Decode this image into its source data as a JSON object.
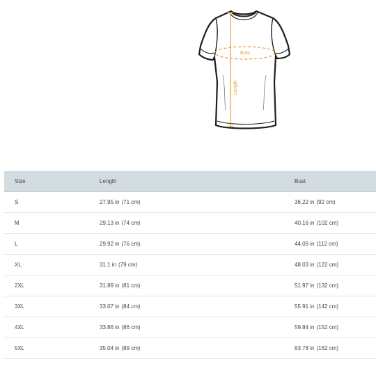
{
  "figure": {
    "icon": "tshirt-outline-icon",
    "accent": "#e8a33d",
    "bust_label": "Bust",
    "length_label": "Length"
  },
  "table": {
    "headers": {
      "size": "Size",
      "length": "Length",
      "bust": "Bust"
    },
    "header_bg": "#d3dde1",
    "rows": [
      {
        "size": "S",
        "length_in": "27.95 in",
        "length_cm": "(71 cm)",
        "bust_in": "36.22 in",
        "bust_cm": "(92 cm)"
      },
      {
        "size": "M",
        "length_in": "29.13 in",
        "length_cm": "(74 cm)",
        "bust_in": "40.16 in",
        "bust_cm": "(102 cm)"
      },
      {
        "size": "L",
        "length_in": "29.92 in",
        "length_cm": "(76 cm)",
        "bust_in": "44.09 in",
        "bust_cm": "(112 cm)"
      },
      {
        "size": "XL",
        "length_in": "31.1 in",
        "length_cm": "(79 cm)",
        "bust_in": "48.03 in",
        "bust_cm": "(122 cm)"
      },
      {
        "size": "2XL",
        "length_in": "31.89 in",
        "length_cm": "(81 cm)",
        "bust_in": "51.97 in",
        "bust_cm": "(132 cm)"
      },
      {
        "size": "3XL",
        "length_in": "33.07 in",
        "length_cm": "(84 cm)",
        "bust_in": "55.91 in",
        "bust_cm": "(142 cm)"
      },
      {
        "size": "4XL",
        "length_in": "33.86 in",
        "length_cm": "(86 cm)",
        "bust_in": "59.84 in",
        "bust_cm": "(152 cm)"
      },
      {
        "size": "5XL",
        "length_in": "35.04 in",
        "length_cm": "(89 cm)",
        "bust_in": "63.78 in",
        "bust_cm": "(162 cm)"
      }
    ]
  }
}
